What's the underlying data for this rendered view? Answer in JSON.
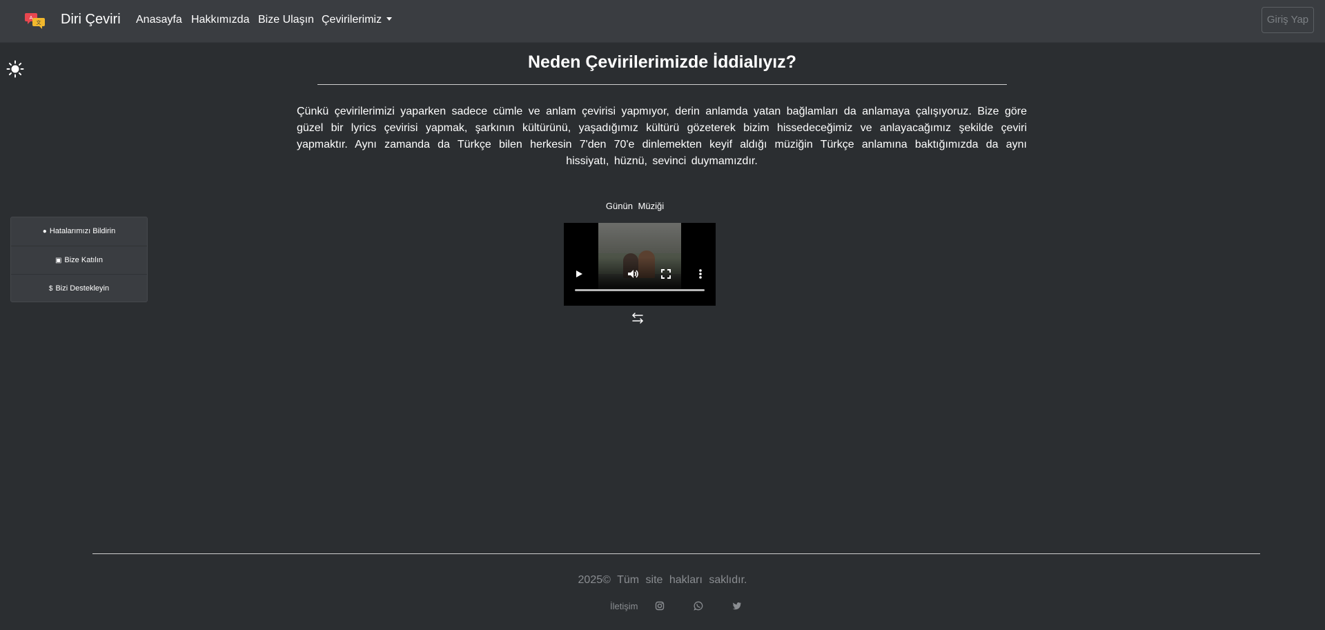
{
  "navbar": {
    "brand": "Diri Çeviri",
    "links": [
      "Anasayfa",
      "Hakkımızda",
      "Bize Ulaşın",
      "Çevirilerimiz"
    ],
    "login_label": "Giriş Yap"
  },
  "main": {
    "title": "Neden Çevirilerimizde İddialıyız?",
    "intro": "Çünkü çevirilerimizi yaparken sadece cümle ve anlam çevirisi yapmıyor, derin anlamda yatan bağlamları da anlamaya çalışıyoruz. Bize göre güzel bir lyrics çevirisi yapmak, şarkının kültürünü, yaşadığımız kültürü gözeterek bizim hissedeceğimiz ve anlayacağımız şekilde çeviri yapmaktır. Aynı zamanda da Türkçe bilen herkesin 7'den 70'e dinlemekten keyif aldığı müziğin Türkçe anlamına baktığımızda da aynı hissiyatı, hüznü, sevinci duymamızdır.",
    "music_label": "Günün Müziği"
  },
  "side_panel": {
    "items": [
      {
        "icon": "!",
        "label": "Hatalarımızı Bildirin"
      },
      {
        "icon": "▣",
        "label": "Bize Katılın"
      },
      {
        "icon": "$",
        "label": "Bizi Destekleyin"
      }
    ]
  },
  "footer": {
    "copyright": "2025© Tüm site hakları saklıdır.",
    "contact_label": "İletişim"
  },
  "icons": {
    "theme": "sun-icon",
    "social": [
      "instagram-icon",
      "whatsapp-icon",
      "twitter-icon"
    ]
  },
  "colors": {
    "background": "#2b2e31",
    "navbar": "#3a3d41",
    "muted_text": "#8a8d91"
  }
}
